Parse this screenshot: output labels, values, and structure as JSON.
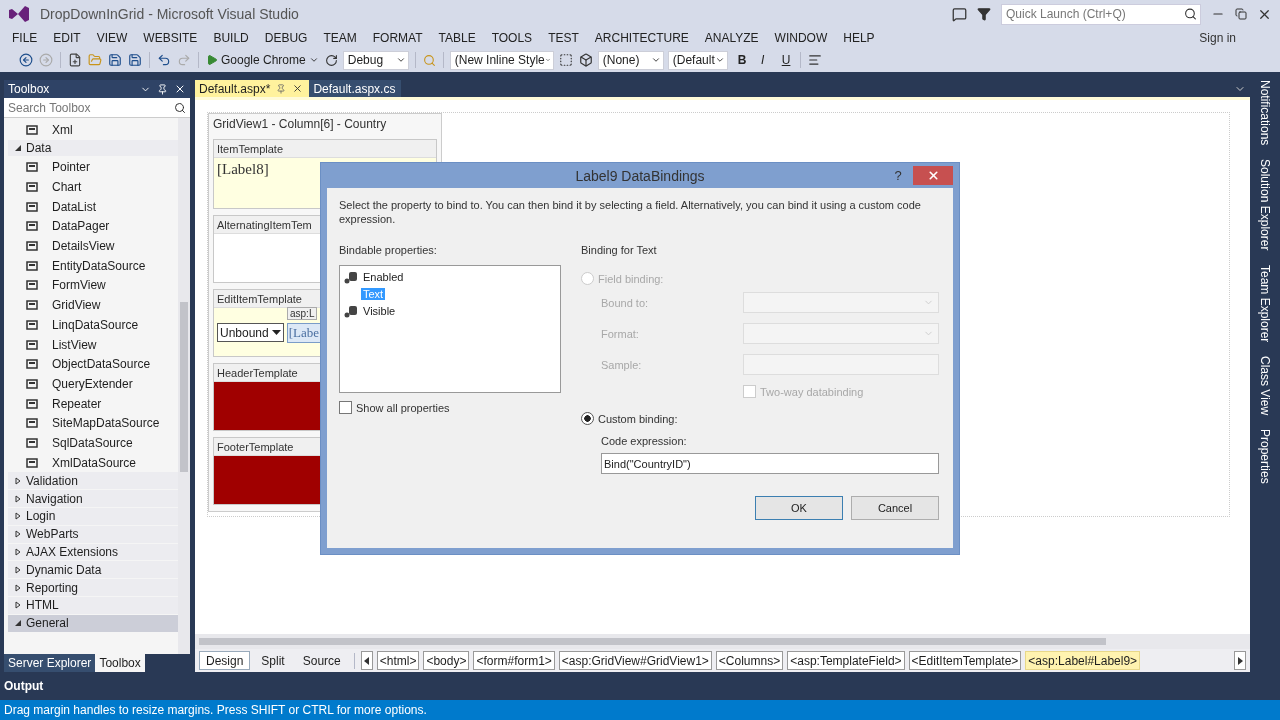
{
  "window": {
    "title": "DropDownInGrid - Microsoft Visual Studio"
  },
  "quick_launch": {
    "placeholder": "Quick Launch (Ctrl+Q)"
  },
  "menu": [
    "FILE",
    "EDIT",
    "VIEW",
    "WEBSITE",
    "BUILD",
    "DEBUG",
    "TEAM",
    "FORMAT",
    "TABLE",
    "TOOLS",
    "TEST",
    "ARCHITECTURE",
    "ANALYZE",
    "WINDOW",
    "HELP"
  ],
  "sign_in": "Sign in",
  "toolbar": {
    "run_target": "Google Chrome",
    "configuration": "Debug",
    "style": "(New Inline Style",
    "target_rule": "(None)",
    "font": "(Default",
    "format_buttons": [
      "B",
      "I",
      "U"
    ]
  },
  "toolbox": {
    "title": "Toolbox",
    "search": {
      "placeholder": "Search Toolbox"
    },
    "items": [
      {
        "kind": "item",
        "label": "Xml"
      },
      {
        "kind": "group",
        "label": "Data",
        "expanded": true,
        "selected": false,
        "children": [
          {
            "label": "Pointer"
          },
          {
            "label": "Chart"
          },
          {
            "label": "DataList"
          },
          {
            "label": "DataPager"
          },
          {
            "label": "DetailsView"
          },
          {
            "label": "EntityDataSource"
          },
          {
            "label": "FormView"
          },
          {
            "label": "GridView"
          },
          {
            "label": "LinqDataSource"
          },
          {
            "label": "ListView"
          },
          {
            "label": "ObjectDataSource"
          },
          {
            "label": "QueryExtender"
          },
          {
            "label": "Repeater"
          },
          {
            "label": "SiteMapDataSource"
          },
          {
            "label": "SqlDataSource"
          },
          {
            "label": "XmlDataSource"
          }
        ]
      },
      {
        "kind": "group",
        "label": "Validation",
        "expanded": false,
        "selected": false
      },
      {
        "kind": "group",
        "label": "Navigation",
        "expanded": false,
        "selected": false
      },
      {
        "kind": "group",
        "label": "Login",
        "expanded": false,
        "selected": false
      },
      {
        "kind": "group",
        "label": "WebParts",
        "expanded": false,
        "selected": false
      },
      {
        "kind": "group",
        "label": "AJAX Extensions",
        "expanded": false,
        "selected": false
      },
      {
        "kind": "group",
        "label": "Dynamic Data",
        "expanded": false,
        "selected": false
      },
      {
        "kind": "group",
        "label": "Reporting",
        "expanded": false,
        "selected": false
      },
      {
        "kind": "group",
        "label": "HTML",
        "expanded": false,
        "selected": false
      },
      {
        "kind": "group",
        "label": "General",
        "expanded": true,
        "selected": true
      }
    ]
  },
  "toolbox_tabs": [
    {
      "label": "Server Explorer",
      "selected": false
    },
    {
      "label": "Toolbox",
      "selected": true
    }
  ],
  "output_label": "Output",
  "editor_tabs": [
    {
      "label": "Default.aspx*",
      "selected": true
    },
    {
      "label": "Default.aspx.cs",
      "selected": false
    }
  ],
  "designer": {
    "grid_title": "GridView1 - Column[6] - Country",
    "templates": [
      {
        "name": "ItemTemplate",
        "kind": "label",
        "text": "[Label8]"
      },
      {
        "name": "AlternatingItemTem",
        "kind": "empty"
      },
      {
        "name": "EditItemTemplate",
        "kind": "edit",
        "dropdown": "Unbound",
        "tag": "asp:L",
        "text": "[Labe"
      },
      {
        "name": "HeaderTemplate",
        "kind": "band"
      },
      {
        "name": "FooterTemplate",
        "kind": "band"
      }
    ]
  },
  "dialog": {
    "title": "Label9 DataBindings",
    "help": "?",
    "intro": "Select the property to bind to. You can then bind it by selecting a field. Alternatively, you can bind it using a custom code expression.",
    "bindable_label": "Bindable properties:",
    "properties": [
      {
        "label": "Enabled",
        "has_icon": true,
        "selected": false
      },
      {
        "label": "Text",
        "has_icon": false,
        "selected": true
      },
      {
        "label": "Visible",
        "has_icon": true,
        "selected": false
      }
    ],
    "show_all": {
      "label": "Show all properties",
      "checked": false
    },
    "binding_title": "Binding for Text",
    "field_binding": {
      "label": "Field binding:",
      "selected": false,
      "disabled": true
    },
    "bound_to": "Bound to:",
    "format": "Format:",
    "sample": "Sample:",
    "two_way": {
      "label": "Two-way databinding",
      "checked": false,
      "disabled": true
    },
    "custom_binding": {
      "label": "Custom binding:",
      "selected": true
    },
    "code_label": "Code expression:",
    "code_value": "Bind(\"CountryID\")",
    "buttons": [
      "OK",
      "Cancel"
    ]
  },
  "view_tabs": [
    {
      "label": "Design",
      "selected": true
    },
    {
      "label": "Split",
      "selected": false
    },
    {
      "label": "Source",
      "selected": false
    }
  ],
  "breadcrumbs": [
    {
      "label": "<html>",
      "selected": false
    },
    {
      "label": "<body>",
      "selected": false
    },
    {
      "label": "<form#form1>",
      "selected": false
    },
    {
      "label": "<asp:GridView#GridView1>",
      "selected": false
    },
    {
      "label": "<Columns>",
      "selected": false
    },
    {
      "label": "<asp:TemplateField>",
      "selected": false
    },
    {
      "label": "<EditItemTemplate>",
      "selected": false
    },
    {
      "label": "<asp:Label#Label9>",
      "selected": true
    }
  ],
  "side_tabs": [
    "Notifications",
    "Solution Explorer",
    "Team Explorer",
    "Class View",
    "Properties"
  ],
  "status": "Drag margin handles to resize margins. Press SHIFT or CTRL for more options."
}
